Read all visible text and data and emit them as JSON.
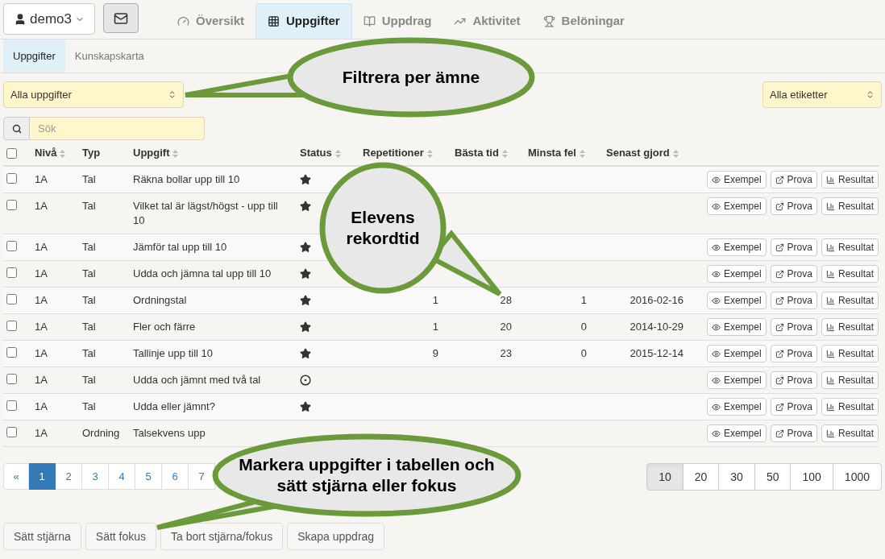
{
  "user_menu": {
    "label": "demo3"
  },
  "tabs": [
    {
      "label": "Översikt",
      "selected": false
    },
    {
      "label": "Uppgifter",
      "selected": true
    },
    {
      "label": "Uppdrag",
      "selected": false
    },
    {
      "label": "Aktivitet",
      "selected": false
    },
    {
      "label": "Belöningar",
      "selected": false
    }
  ],
  "subtabs": [
    {
      "label": "Uppgifter",
      "selected": true
    },
    {
      "label": "Kunskapskarta",
      "selected": false
    }
  ],
  "filters": {
    "subject": "Alla uppgifter",
    "tags": "Alla etiketter"
  },
  "search": {
    "placeholder": "Sök"
  },
  "table": {
    "select_all": {
      "checked": false
    },
    "columns": [
      {
        "label": "Nivå",
        "sortable": true
      },
      {
        "label": "Typ",
        "sortable": false
      },
      {
        "label": "Uppgift",
        "sortable": true
      },
      {
        "label": "Status",
        "sortable": true
      },
      {
        "label": "Repetitioner",
        "sortable": true
      },
      {
        "label": "Bästa tid",
        "sortable": true
      },
      {
        "label": "Minsta fel",
        "sortable": true
      },
      {
        "label": "Senast gjord",
        "sortable": true
      }
    ],
    "rows": [
      {
        "checked": false,
        "level": "1A",
        "type": "Tal",
        "task": "Räkna bollar upp till 10",
        "kind": "star",
        "actions": [
          "Exempel",
          "Prova",
          "Resultat"
        ]
      },
      {
        "checked": false,
        "level": "1A",
        "type": "Tal",
        "task": "Vilket tal är lägst/högst - upp till 10",
        "kind": "star",
        "actions": [
          "Exempel",
          "Prova",
          "Resultat"
        ]
      },
      {
        "checked": false,
        "level": "1A",
        "type": "Tal",
        "task": "Jämför tal upp till 10",
        "kind": "star",
        "actions": [
          "Exempel",
          "Prova",
          "Resultat"
        ]
      },
      {
        "checked": false,
        "level": "1A",
        "type": "Tal",
        "task": "Udda och jämna tal upp till 10",
        "kind": "star",
        "actions": [
          "Exempel",
          "Prova",
          "Resultat"
        ]
      },
      {
        "checked": false,
        "level": "1A",
        "type": "Tal",
        "task": "Ordningstal",
        "kind": "star",
        "repetitions": "1",
        "best_time": "28",
        "min_errors": "1",
        "last_done": "2016-02-16",
        "actions": [
          "Exempel",
          "Prova",
          "Resultat"
        ]
      },
      {
        "checked": false,
        "level": "1A",
        "type": "Tal",
        "task": "Fler och färre",
        "kind": "star",
        "repetitions": "1",
        "best_time": "20",
        "min_errors": "0",
        "last_done": "2014-10-29",
        "actions": [
          "Exempel",
          "Prova",
          "Resultat"
        ]
      },
      {
        "checked": false,
        "level": "1A",
        "type": "Tal",
        "task": "Tallinje upp till 10",
        "kind": "star",
        "repetitions": "9",
        "best_time": "23",
        "min_errors": "0",
        "last_done": "2015-12-14",
        "actions": [
          "Exempel",
          "Prova",
          "Resultat"
        ]
      },
      {
        "checked": false,
        "level": "1A",
        "type": "Tal",
        "task": "Udda och jämnt med två tal",
        "kind": "focus",
        "actions": [
          "Exempel",
          "Prova",
          "Resultat"
        ]
      },
      {
        "checked": false,
        "level": "1A",
        "type": "Tal",
        "task": "Udda eller jämnt?",
        "kind": "star",
        "actions": [
          "Exempel",
          "Prova",
          "Resultat"
        ]
      },
      {
        "checked": false,
        "level": "1A",
        "type": "Ordning",
        "task": "Talsekvens upp",
        "actions": [
          "Exempel",
          "Prova",
          "Resultat"
        ]
      }
    ]
  },
  "pagination": {
    "prev": "«",
    "pages": [
      {
        "label": "1",
        "selected": true
      },
      {
        "label": "2",
        "selected": false
      },
      {
        "label": "3",
        "selected": false
      },
      {
        "label": "4",
        "selected": false
      },
      {
        "label": "5",
        "selected": false
      },
      {
        "label": "6",
        "selected": false
      },
      {
        "label": "7",
        "selected": false
      }
    ]
  },
  "page_sizes": [
    {
      "label": "10",
      "selected": true
    },
    {
      "label": "20",
      "selected": false
    },
    {
      "label": "30",
      "selected": false
    },
    {
      "label": "50",
      "selected": false
    },
    {
      "label": "100",
      "selected": false
    },
    {
      "label": "1000",
      "selected": false
    }
  ],
  "bulk_buttons": [
    "Sätt stjärna",
    "Sätt fokus",
    "Ta bort stjärna/fokus",
    "Skapa uppdrag"
  ],
  "callouts": [
    {
      "text": "Filtrera per ämne"
    },
    {
      "text": "Elevens rekordtid"
    },
    {
      "text": "Markera uppgifter i tabellen och sätt stjärna eller fokus"
    }
  ]
}
